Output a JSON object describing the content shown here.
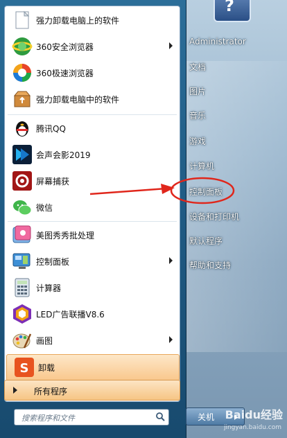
{
  "left_items": [
    {
      "label": "强力卸载电脑上的软件",
      "icon": "document-icon",
      "has_arrow": false
    },
    {
      "label": "360安全浏览器",
      "icon": "360-browser-icon",
      "has_arrow": true
    },
    {
      "label": "360极速浏览器",
      "icon": "360-speed-browser-icon",
      "has_arrow": false
    },
    {
      "label": "强力卸载电脑中的软件",
      "icon": "uninstall-box-icon",
      "has_arrow": false
    },
    {
      "label": "腾讯QQ",
      "icon": "qq-penguin-icon",
      "has_arrow": false
    },
    {
      "label": "会声会影2019",
      "icon": "video-editor-icon",
      "has_arrow": false
    },
    {
      "label": "屏幕捕获",
      "icon": "screen-capture-icon",
      "has_arrow": false
    },
    {
      "label": "微信",
      "icon": "wechat-icon",
      "has_arrow": false
    },
    {
      "label": "美图秀秀批处理",
      "icon": "meitu-icon",
      "has_arrow": false
    },
    {
      "label": "控制面板",
      "icon": "control-panel-icon",
      "has_arrow": true
    },
    {
      "label": "计算器",
      "icon": "calculator-icon",
      "has_arrow": false
    },
    {
      "label": "LED广告联播V8.6",
      "icon": "led-icon",
      "has_arrow": false
    },
    {
      "label": "画图",
      "icon": "paint-icon",
      "has_arrow": true
    },
    {
      "label": "卸载",
      "icon": "uninstall-s-icon",
      "has_arrow": false
    }
  ],
  "all_programs": "所有程序",
  "search_placeholder": "搜索程序和文件",
  "right_items": [
    "Administrator",
    "文档",
    "图片",
    "音乐",
    "游戏",
    "计算机",
    "控制面板",
    "设备和打印机",
    "默认程序",
    "帮助和支持"
  ],
  "shutdown_label": "关机",
  "watermark": "Baidu经验",
  "watermark_sub": "jingyan.baidu.com",
  "colors": {
    "highlight": "#f9c78c",
    "annotation": "#e0261b"
  }
}
